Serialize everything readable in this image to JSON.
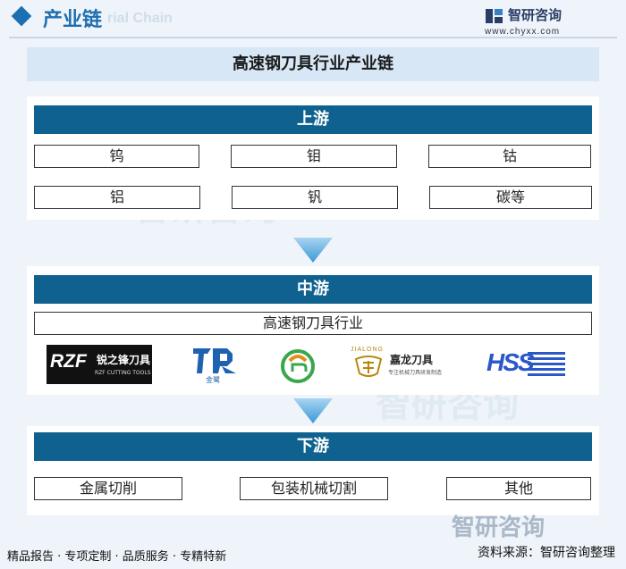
{
  "header": {
    "title": "产业链",
    "ghost_text": "rial Chain"
  },
  "logo": {
    "name": "智研咨询",
    "url": "www.chyxx.com"
  },
  "diagram": {
    "title": "高速钢刀具行业产业链",
    "upstream": {
      "label": "上游",
      "items": [
        "钨",
        "钼",
        "钴",
        "铝",
        "钒",
        "碳等"
      ]
    },
    "midstream": {
      "label": "中游",
      "industry": "高速钢刀具行业",
      "brands": {
        "rzf_main": "RZF",
        "rzf_cn": "锐之锋刀具",
        "rzf_en": "RZF CUTTING TOOLS",
        "jinlu": "金鹭",
        "jialong_cn": "嘉龙刀具",
        "jialong_sub": "专注机械刀具研发制造",
        "jialong_en": "JIALONG",
        "hss": "HSS"
      }
    },
    "downstream": {
      "label": "下游",
      "items": [
        "金属切削",
        "包装机械切割",
        "其他"
      ]
    }
  },
  "footer": {
    "left": "精品报告 · 专项定制 · 品质服务 · 专精特新",
    "right": "资料来源：智研咨询整理",
    "watermark_big": "智研咨询"
  },
  "colors": {
    "band": "#0f628f",
    "accent": "#1e6fb0",
    "arrow": "#4aa3df"
  }
}
